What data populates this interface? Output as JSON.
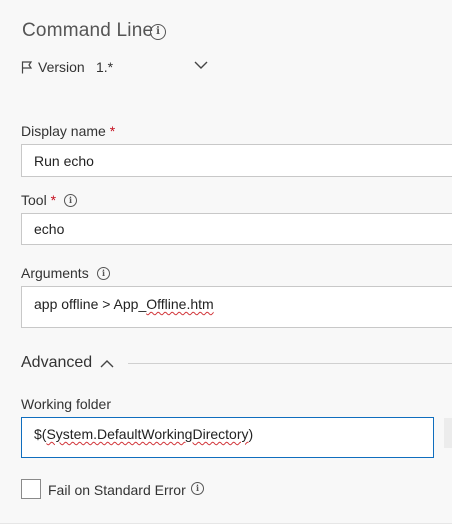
{
  "header": {
    "title": "Command Line",
    "info_icon": "info-icon",
    "version_label": "Version",
    "version_value": "1.*",
    "flag_icon": "flag-icon",
    "dropdown_icon": "chevron-down-icon"
  },
  "display_name": {
    "label": "Display name",
    "required": "*",
    "value": "Run echo"
  },
  "tool": {
    "label": "Tool",
    "required": "*",
    "value": "echo"
  },
  "arguments": {
    "label": "Arguments",
    "value_prefix": "app offline > App_",
    "value_squiggle": "Offline.htm"
  },
  "advanced": {
    "label": "Advanced",
    "toggle_icon": "chevron-up-icon"
  },
  "working_folder": {
    "label": "Working folder",
    "value_prefix": "$(",
    "value_squiggle": "System.DefaultWorkingDirectory",
    "value_suffix": ")"
  },
  "fail_on_stderr": {
    "label": "Fail on Standard Error",
    "checked": false
  },
  "colors": {
    "background": "#f8f8f8",
    "required": "#c50f1f",
    "focus_border": "#106ebe",
    "input_border": "#c8c8c8",
    "spellcheck": "#d13438"
  }
}
